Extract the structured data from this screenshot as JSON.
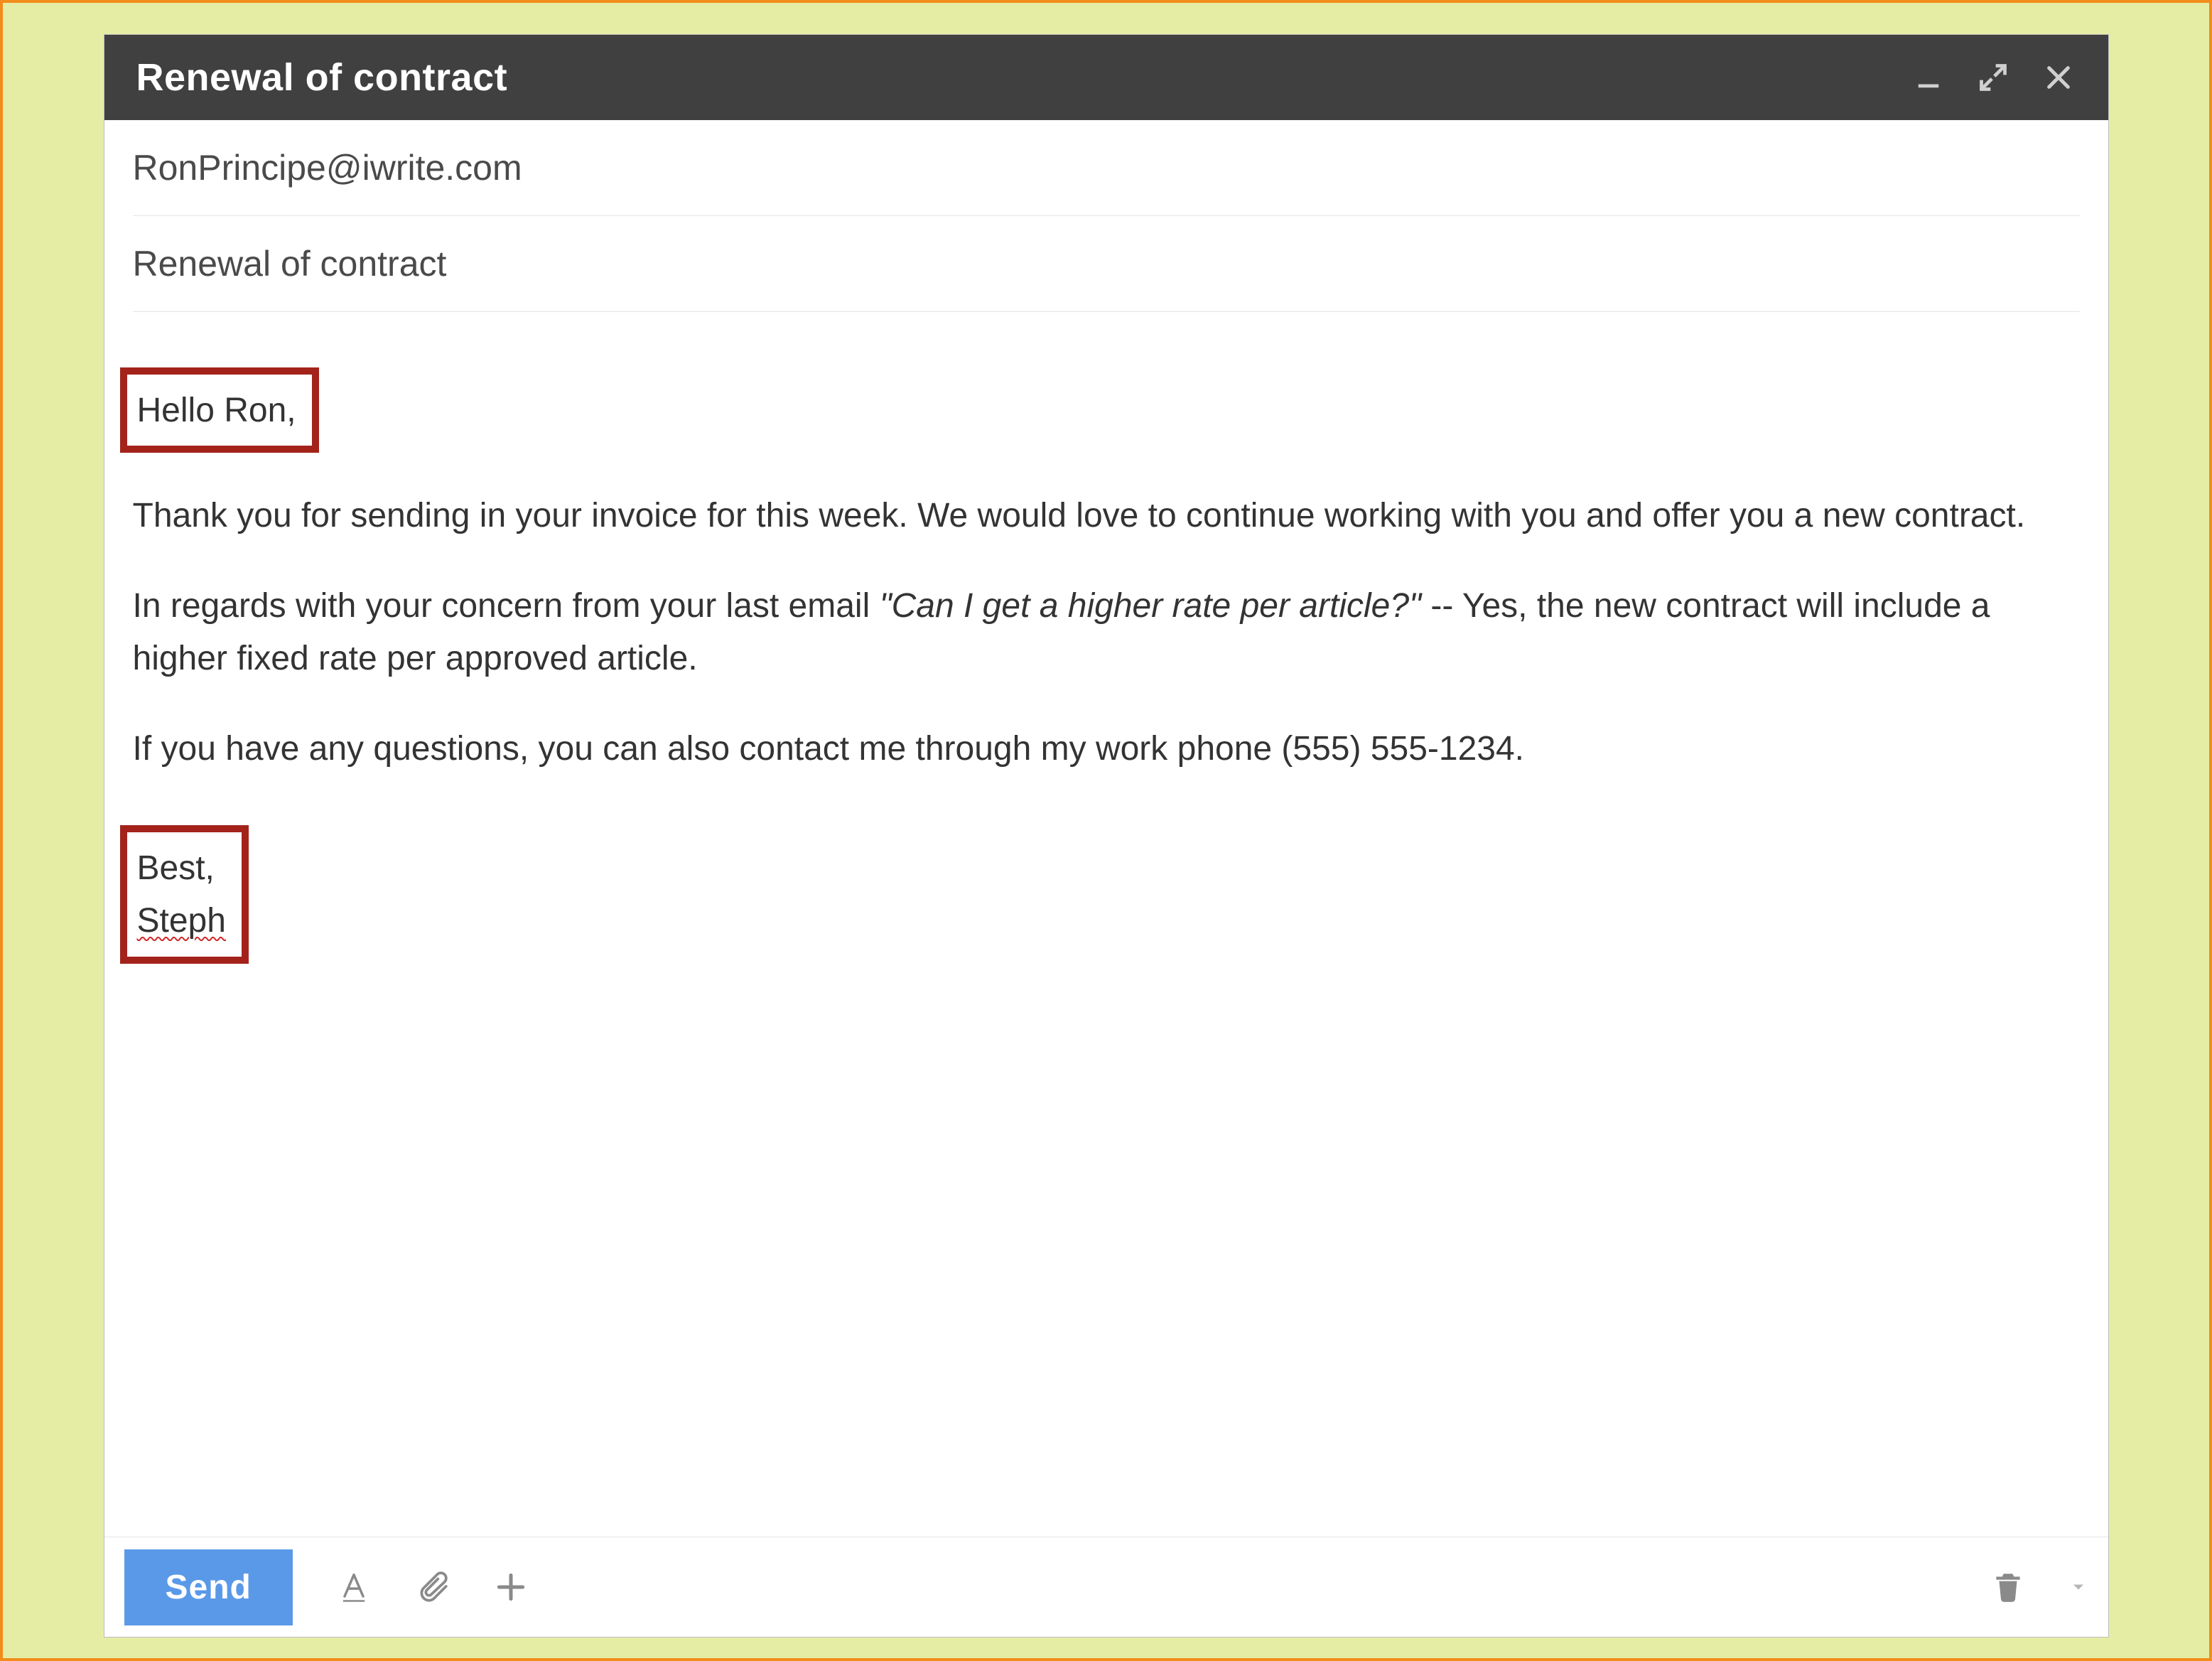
{
  "header": {
    "title": "Renewal of contract"
  },
  "fields": {
    "to": "RonPrincipe@iwrite.com",
    "subject": "Renewal of contract"
  },
  "body": {
    "greeting": "Hello Ron,",
    "p1": "Thank you for sending in your invoice for this week. We would love to continue working with you and offer you a new contract.",
    "p2_a": "In regards with your concern from your last email ",
    "p2_quote": "\"Can I get a higher rate per article?\"",
    "p2_b": " -- Yes, the new contract will include a higher fixed rate per approved article.",
    "p3": "If you have any questions, you can also contact me through my work phone (555) 555-1234.",
    "closing_a": "Best,",
    "closing_b": "Steph"
  },
  "toolbar": {
    "send_label": "Send"
  }
}
